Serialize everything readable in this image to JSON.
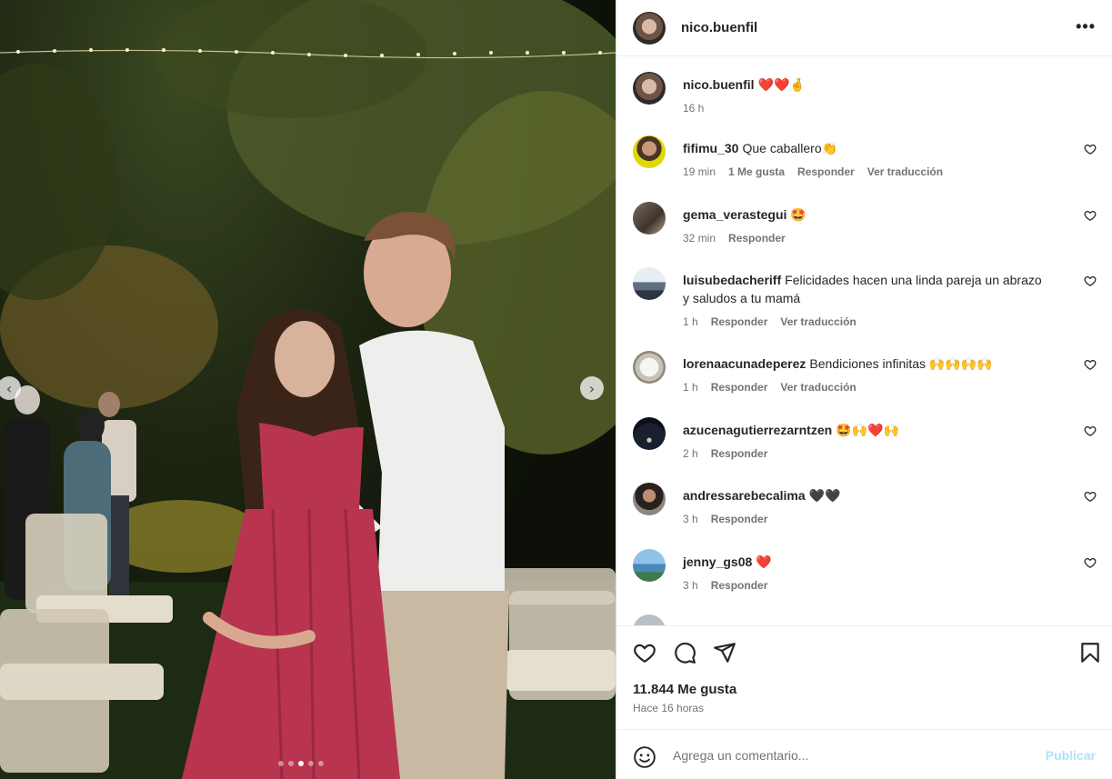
{
  "post": {
    "author": "nico.buenfil",
    "caption": "❤️❤️🤞",
    "caption_time": "16 h",
    "carousel": {
      "count": 5,
      "active": 3
    }
  },
  "comments": [
    {
      "user": "fifimu_30",
      "text": "Que caballero👏",
      "time": "19 min",
      "likes": "1 Me gusta",
      "reply": "Responder",
      "translate": "Ver traducción"
    },
    {
      "user": "gema_verastegui",
      "text": "🤩",
      "time": "32 min",
      "reply": "Responder"
    },
    {
      "user": "luisubedacheriff",
      "text": "Felicidades hacen una linda pareja un abrazo y saludos a tu mamá",
      "time": "1 h",
      "reply": "Responder",
      "translate": "Ver traducción"
    },
    {
      "user": "lorenaacunadeperez",
      "text": "Bendiciones infinitas 🙌🙌🙌🙌",
      "time": "1 h",
      "reply": "Responder",
      "translate": "Ver traducción"
    },
    {
      "user": "azucenagutierrezarntzen",
      "text": "🤩🙌❤️🙌",
      "time": "2 h",
      "reply": "Responder"
    },
    {
      "user": "andressarebecalima",
      "text": "🖤🖤",
      "time": "3 h",
      "reply": "Responder"
    },
    {
      "user": "jenny_gs08",
      "text": "❤️",
      "time": "3 h",
      "reply": "Responder"
    }
  ],
  "stats": {
    "likes": "11.844 Me gusta",
    "posted": "Hace 16 horas"
  },
  "composer": {
    "placeholder": "Agrega un comentario...",
    "publish": "Publicar"
  },
  "icons": {
    "more": "more-horizontal-icon",
    "like": "heart-icon",
    "comment": "comment-icon",
    "share": "paper-plane-icon",
    "save": "bookmark-icon",
    "emoji": "smiley-icon"
  },
  "colors": {
    "publish_disabled": "#b2dffc",
    "secondary_text": "#737373",
    "dress": "#b8344f"
  }
}
